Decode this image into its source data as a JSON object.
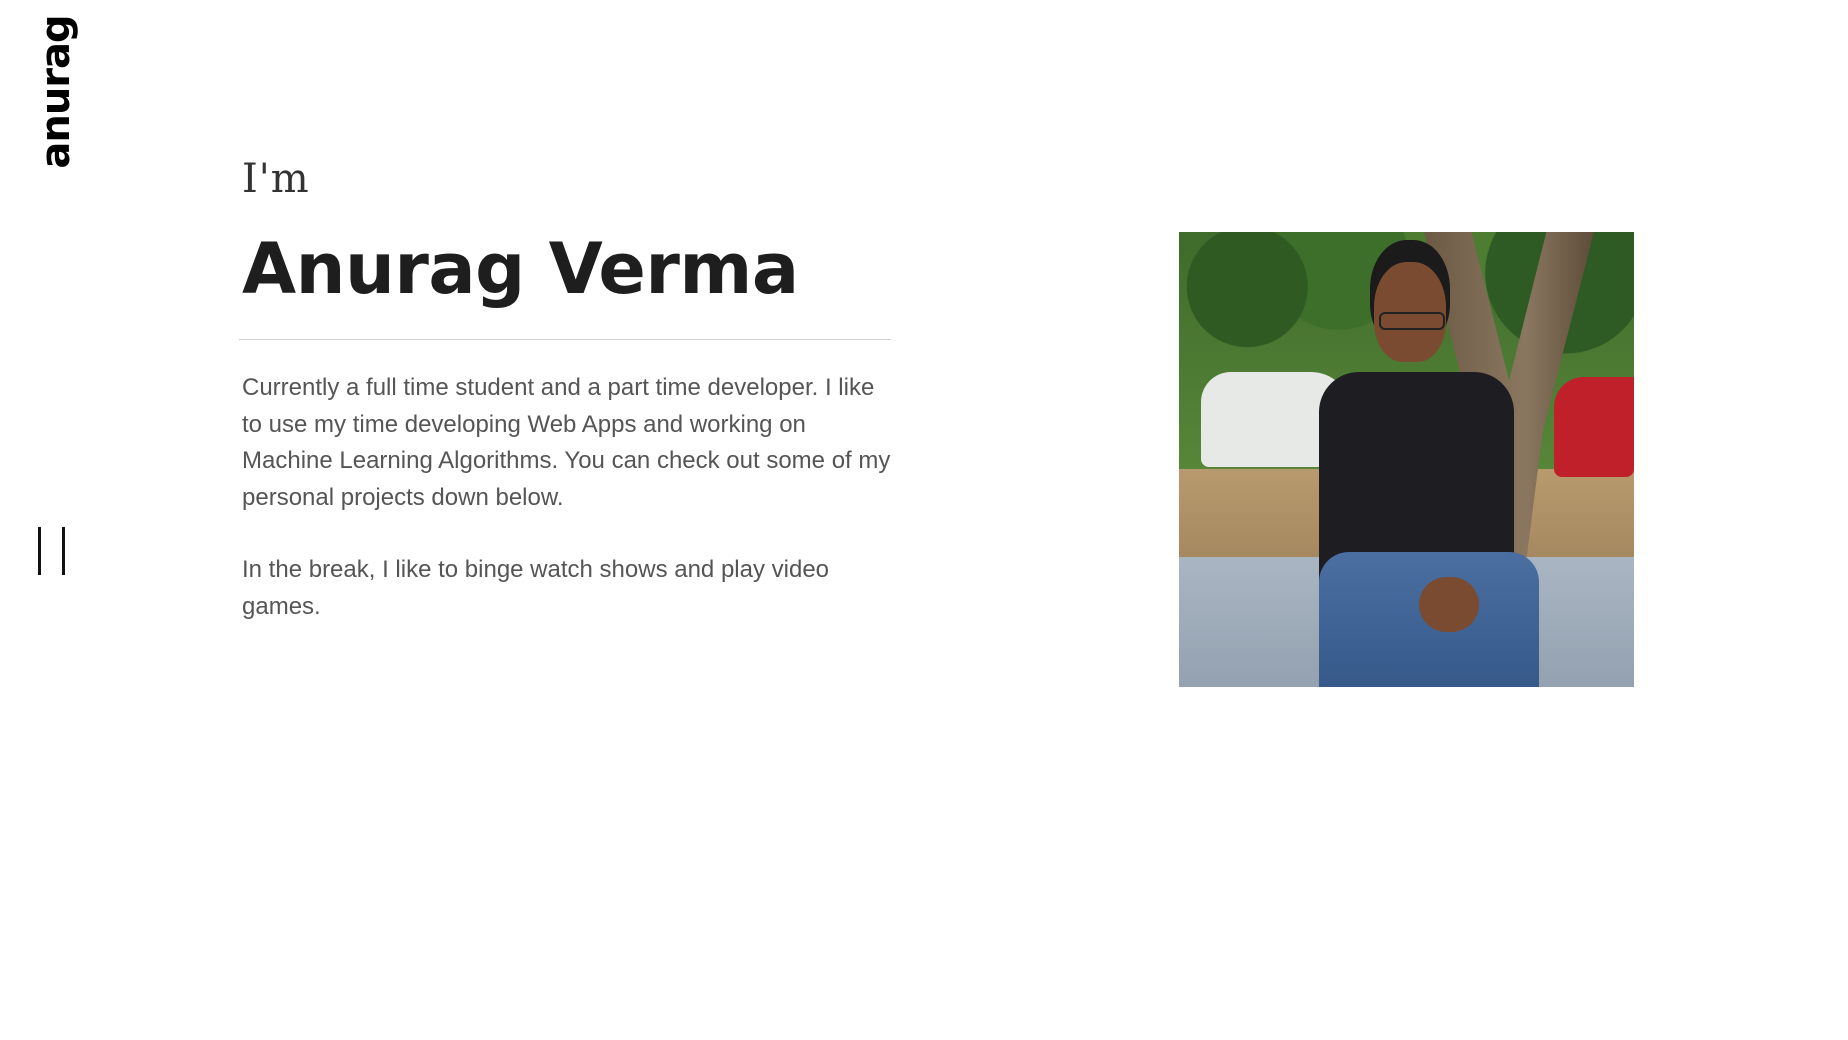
{
  "brand": {
    "name": "anurag"
  },
  "hero": {
    "intro": "I'm",
    "name": "Anurag Verma",
    "bio": [
      "Currently a full time student and a part time developer. I like to use my time developing Web Apps and working on Machine Learning Algorithms. You can check out some of my personal projects down below.",
      "In the break, I like to binge watch shows and play video games."
    ]
  },
  "menu": {
    "icon": "menu-toggle-icon"
  },
  "photo": {
    "icon": "profile-photo"
  }
}
